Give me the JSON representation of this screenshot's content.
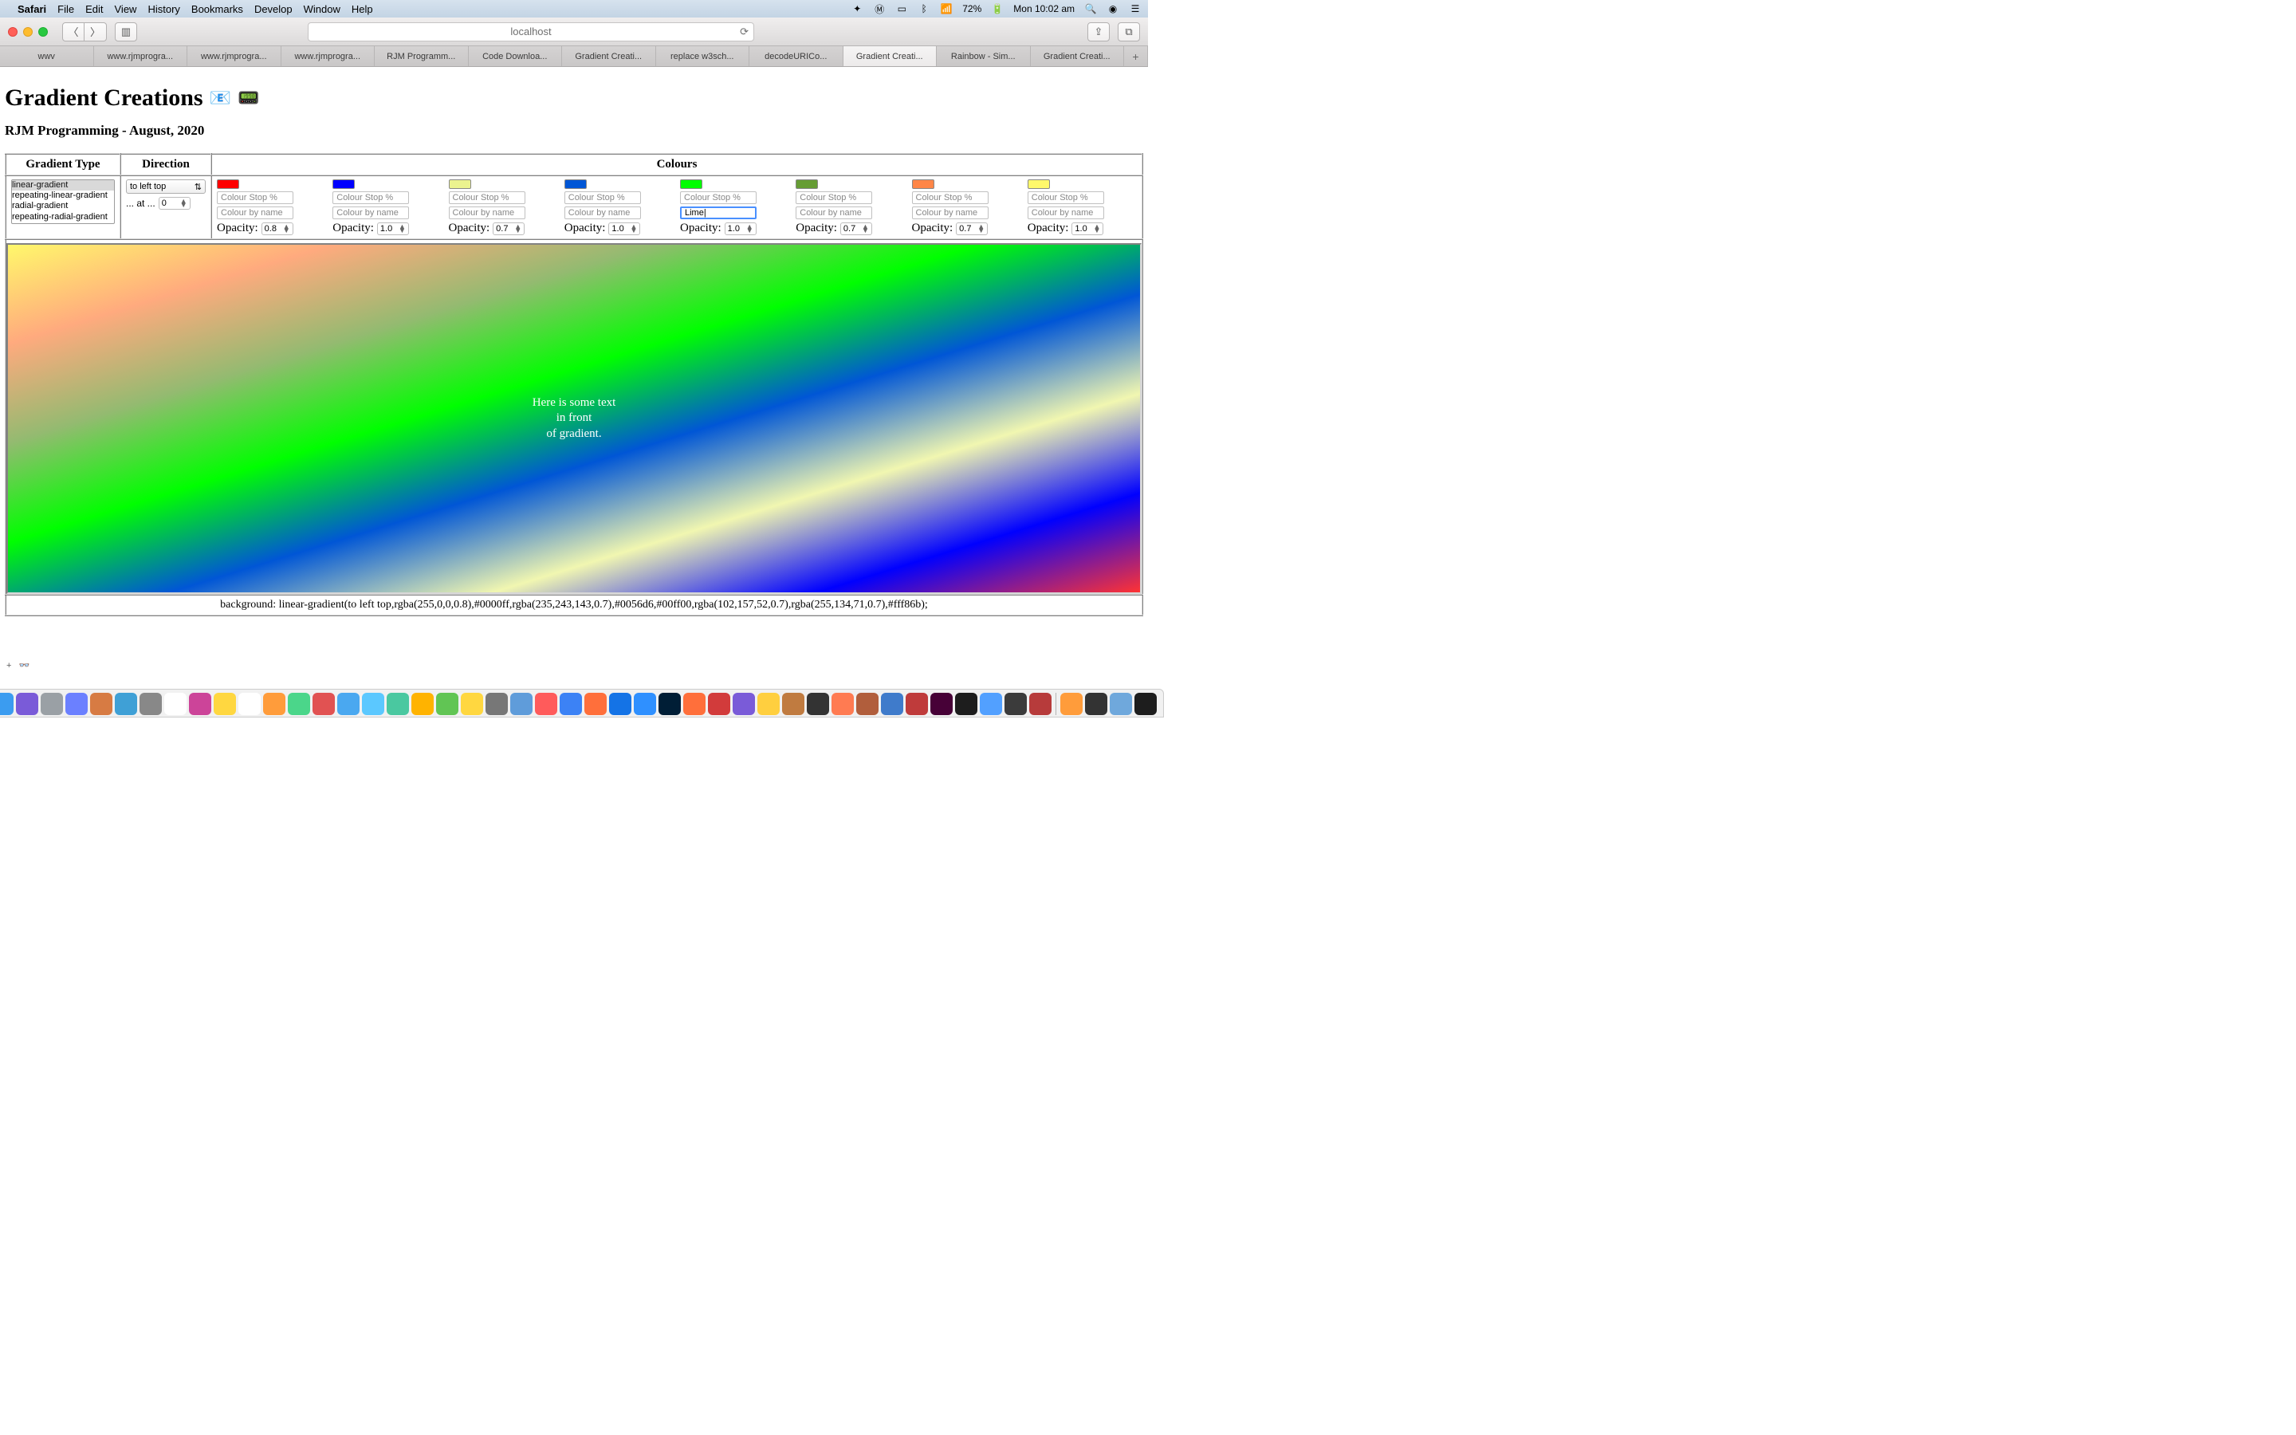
{
  "menubar": {
    "app": "Safari",
    "items": [
      "File",
      "Edit",
      "View",
      "History",
      "Bookmarks",
      "Develop",
      "Window",
      "Help"
    ],
    "battery": "72%",
    "clock": "Mon 10:02 am"
  },
  "toolbar": {
    "url": "localhost"
  },
  "tabs": [
    {
      "label": "wwv",
      "active": false
    },
    {
      "label": "www.rjmprogra...",
      "active": false
    },
    {
      "label": "www.rjmprogra...",
      "active": false
    },
    {
      "label": "www.rjmprogra...",
      "active": false
    },
    {
      "label": "RJM Programm...",
      "active": false
    },
    {
      "label": "Code Downloa...",
      "active": false
    },
    {
      "label": "Gradient Creati...",
      "active": false
    },
    {
      "label": "replace w3sch...",
      "active": false
    },
    {
      "label": "decodeURICo...",
      "active": false
    },
    {
      "label": "Gradient Creati...",
      "active": true
    },
    {
      "label": "Rainbow - Sim...",
      "active": false
    },
    {
      "label": "Gradient Creati...",
      "active": false
    }
  ],
  "page": {
    "title": "Gradient Creations",
    "subtitle": "RJM Programming - August, 2020",
    "headers": {
      "type": "Gradient Type",
      "direction": "Direction",
      "colours": "Colours"
    },
    "gradient_types": [
      "linear-gradient",
      "repeating-linear-gradient",
      "radial-gradient",
      "repeating-radial-gradient"
    ],
    "gradient_selected": "linear-gradient",
    "direction": {
      "value": "to left top",
      "at_label": "... at ...",
      "at_value": "0"
    },
    "colour_stop_ph": "Colour Stop %",
    "colour_name_ph": "Colour by name",
    "opacity_label": "Opacity:",
    "colours": [
      {
        "swatch": "#ff0000",
        "name": "",
        "opacity": "0.8"
      },
      {
        "swatch": "#0000ff",
        "name": "",
        "opacity": "1.0"
      },
      {
        "swatch": "#ebf38f",
        "name": "",
        "opacity": "0.7"
      },
      {
        "swatch": "#0056d6",
        "name": "",
        "opacity": "1.0"
      },
      {
        "swatch": "#00ff00",
        "name": "Lime",
        "opacity": "1.0",
        "focused": true
      },
      {
        "swatch": "#669d34",
        "name": "",
        "opacity": "0.7"
      },
      {
        "swatch": "#ff8647",
        "name": "",
        "opacity": "0.7"
      },
      {
        "swatch": "#fff86b",
        "name": "",
        "opacity": "1.0"
      }
    ],
    "overlay": {
      "l1": "Here is some text",
      "l2": "in front",
      "l3": "of gradient."
    },
    "css_output": "background: linear-gradient(to left top,rgba(255,0,0,0.8),#0000ff,rgba(235,243,143,0.7),#0056d6,#00ff00,rgba(102,157,52,0.7),rgba(255,134,71,0.7),#fff86b);"
  },
  "dock_colors": [
    "#3b9cf0",
    "#7a5bd8",
    "#9aa0a5",
    "#6b80ff",
    "#d77b43",
    "#3fa0d6",
    "#888",
    "#fff",
    "#c49",
    "#ffd740",
    "#fff",
    "#ff9c3b",
    "#4bd68a",
    "#e15252",
    "#4aa8f0",
    "#5bc8ff",
    "#4ac8a0",
    "#ffb300",
    "#61c554",
    "#ffd740",
    "#777",
    "#5f9cda",
    "#ff5b5b",
    "#3c82f5",
    "#ff6f3b",
    "#1473e6",
    "#2f90ff",
    "#001e36",
    "#ff6f3b",
    "#d23b3b",
    "#7a5bd8",
    "#ffcf3f",
    "#c07b40",
    "#333",
    "#ff7b52",
    "#b15e3c",
    "#3f7bcb",
    "#bf3b3b",
    "#470137",
    "#1d1d1d",
    "#52a0ff",
    "#3b3b3b",
    "#b73b3b",
    "#ff9c3b",
    "#333",
    "#6fa8dc",
    "#1d1d1d"
  ]
}
